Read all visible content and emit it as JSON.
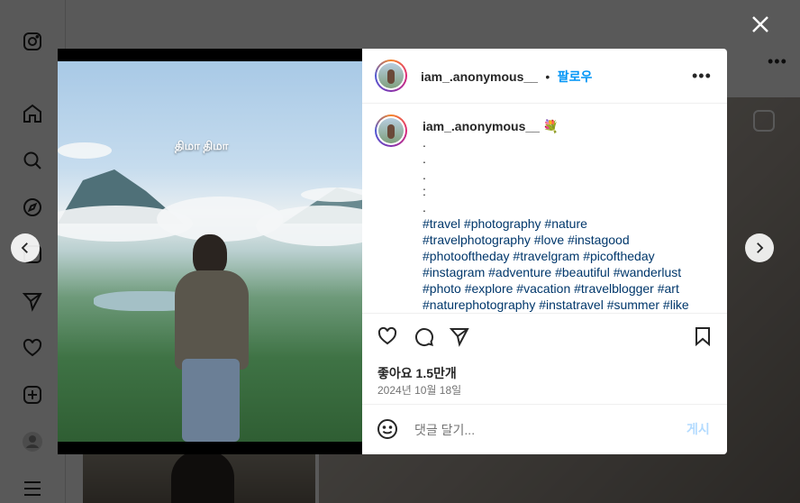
{
  "sidebar": {
    "items": [
      {
        "icon": "instagram-logo-icon"
      },
      {
        "icon": "home-icon"
      },
      {
        "icon": "search-icon"
      },
      {
        "icon": "explore-icon"
      },
      {
        "icon": "reels-icon"
      },
      {
        "icon": "messages-icon"
      },
      {
        "icon": "notifications-icon"
      },
      {
        "icon": "create-icon"
      },
      {
        "icon": "profile-icon"
      },
      {
        "icon": "menu-icon"
      }
    ]
  },
  "post": {
    "overlay_text": "திமா திமா",
    "author": {
      "username": "iam_.anonymous__",
      "separator": "•",
      "follow_label": "팔로우"
    },
    "caption": {
      "username": "iam_.anonymous__",
      "emoji": "💐",
      "lines": [
        ".",
        ".",
        ".",
        ":",
        "."
      ],
      "hashtag_lines": [
        "#travel #photography #nature",
        "#travelphotography #love #instagood",
        "#photooftheday #travelgram #picoftheday",
        "#instagram #adventure #beautiful #wanderlust",
        "#photo #explore #vacation #travelblogger #art",
        "#naturephotography #instatravel #summer #like"
      ]
    },
    "likes_text": "좋아요 1.5만개",
    "date_text": "2024년 10월 18일",
    "comment": {
      "placeholder": "댓글 달기...",
      "post_label": "게시"
    }
  },
  "colors": {
    "link": "#0095f6",
    "hashtag": "#00376b",
    "post_disabled": "#b3dbff",
    "overlay": "rgba(0,0,0,0.65)"
  }
}
